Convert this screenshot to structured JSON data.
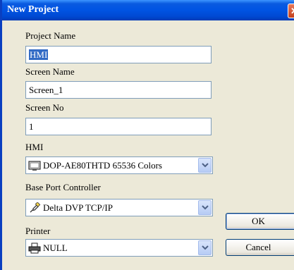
{
  "window": {
    "title": "New Project"
  },
  "fields": {
    "project_name": {
      "label": "Project Name",
      "value": "HMI"
    },
    "screen_name": {
      "label": "Screen Name",
      "value": "Screen_1"
    },
    "screen_no": {
      "label": "Screen No",
      "value": "1"
    }
  },
  "combos": {
    "hmi": {
      "label": "HMI",
      "value": "DOP-AE80THTD 65536 Colors",
      "icon": "monitor-icon"
    },
    "base_port": {
      "label": "Base Port Controller",
      "value": "Delta DVP TCP/IP",
      "icon": "plug-icon"
    },
    "printer": {
      "label": "Printer",
      "value": "NULL",
      "icon": "printer-icon"
    }
  },
  "buttons": {
    "ok": "OK",
    "cancel": "Cancel"
  },
  "colors": {
    "titlebar": "#0054e3",
    "dialog_bg": "#ece9d8",
    "selection": "#316ac5",
    "field_border": "#7f9db9"
  }
}
